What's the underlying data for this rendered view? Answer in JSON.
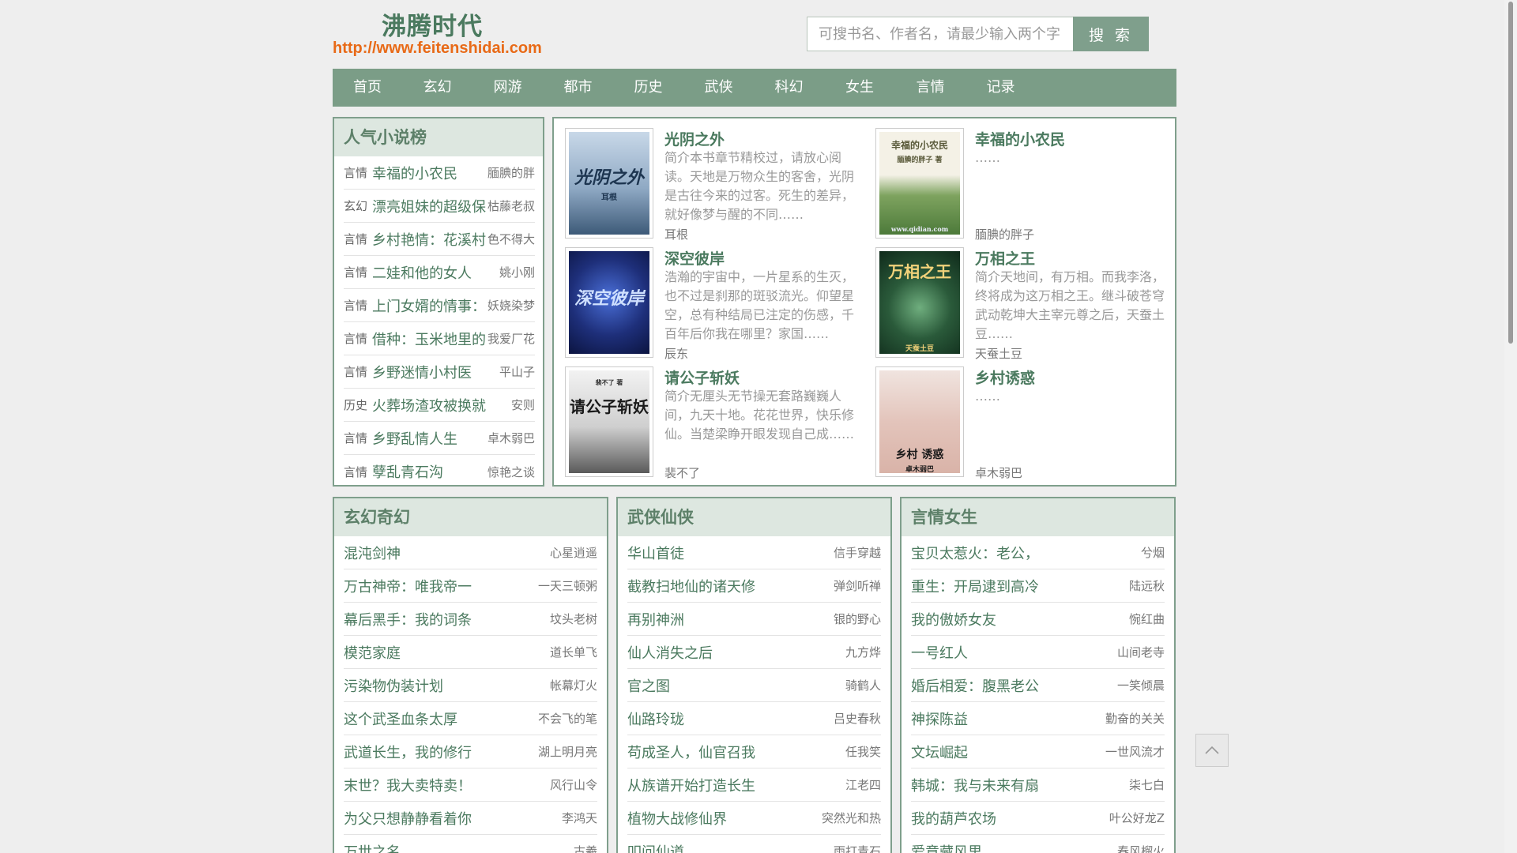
{
  "site": {
    "title": "沸腾时代",
    "url": "http://www.feitenshidai.com"
  },
  "search": {
    "placeholder": "可搜书名、作者名，请最少输入两个字",
    "button_label": "搜 索"
  },
  "nav": [
    "首页",
    "玄幻",
    "网游",
    "都市",
    "历史",
    "武侠",
    "科幻",
    "女生",
    "言情",
    "记录"
  ],
  "ranking": {
    "heading": "人气小说榜",
    "items": [
      {
        "cat": "言情",
        "title": "幸福的小农民",
        "author": "腼腆的胖"
      },
      {
        "cat": "玄幻",
        "title": "漂亮姐妹的超级保",
        "author": "枯藤老叔"
      },
      {
        "cat": "言情",
        "title": "乡村艳情：花溪村",
        "author": "色不得大"
      },
      {
        "cat": "言情",
        "title": "二娃和他的女人",
        "author": "姚小刚"
      },
      {
        "cat": "言情",
        "title": "上门女婿的情事：",
        "author": "妖娆染梦"
      },
      {
        "cat": "言情",
        "title": "借种：玉米地里的",
        "author": "我爱厂花"
      },
      {
        "cat": "言情",
        "title": "乡野迷情小村医",
        "author": "平山子"
      },
      {
        "cat": "历史",
        "title": "火葬场渣攻被换就",
        "author": "安则"
      },
      {
        "cat": "言情",
        "title": "乡野乱情人生",
        "author": "卓木弱巴"
      },
      {
        "cat": "言情",
        "title": "孽乱青石沟",
        "author": "惊艳之谈"
      }
    ]
  },
  "featured": [
    {
      "title": "光阴之外",
      "desc": "简介本书章节精校过，请放心阅读。天地是万物众生的客舍，光阴是古往今来的过客。死生的差异，就好像梦与醒的不同……",
      "author": "耳根",
      "cover_text": "光阴之外",
      "cover_sub": "耳根"
    },
    {
      "title": "幸福的小农民",
      "desc": "……",
      "author": "腼腆的胖子",
      "cover_text": "幸福的小农民",
      "cover_sub": "腼腆的胖子 著",
      "cover_footer": "www.qidian.com"
    },
    {
      "title": "深空彼岸",
      "desc": "浩瀚的宇宙中，一片星系的生灭，也不过是刹那的斑驳流光。仰望星空，总有种结局已注定的伤感，千百年后你我在哪里？家国……",
      "author": "辰东",
      "cover_text": "深空彼岸"
    },
    {
      "title": "万相之王",
      "desc": "简介天地间，有万相。而我李洛，终将成为这万相之王。继斗破苍穹武动乾坤大主宰元尊之后，天蚕土豆……",
      "author": "天蚕土豆",
      "cover_text": "万相之王",
      "cover_sub": "天蚕土豆"
    },
    {
      "title": "请公子斩妖",
      "desc": "简介无厘头无节操无套路巍巍人间，九天十地。花花世界，快乐修仙。当楚梁睁开眼发现自己成……",
      "author": "裴不了",
      "cover_text": "请公子斩妖",
      "cover_sub": "裴不了 著"
    },
    {
      "title": "乡村诱惑",
      "desc": "……",
      "author": "卓木弱巴",
      "cover_text": "乡村 诱惑",
      "cover_sub": "卓木弱巴"
    }
  ],
  "categories": [
    {
      "heading": "玄幻奇幻",
      "items": [
        {
          "title": "混沌剑神",
          "author": "心星逍遥"
        },
        {
          "title": "万古神帝：唯我帝一",
          "author": "一天三顿粥"
        },
        {
          "title": "幕后黑手：我的词条",
          "author": "坟头老树"
        },
        {
          "title": "模范家庭",
          "author": "道长单飞"
        },
        {
          "title": "污染物伪装计划",
          "author": "帐幕灯火"
        },
        {
          "title": "这个武圣血条太厚",
          "author": "不会飞的笔"
        },
        {
          "title": "武道长生，我的修行",
          "author": "湖上明月亮"
        },
        {
          "title": "末世？我大卖特卖！",
          "author": "风行山令"
        },
        {
          "title": "为父只想静静看着你",
          "author": "李鸿天"
        },
        {
          "title": "万世之名",
          "author": "古羲"
        }
      ]
    },
    {
      "heading": "武侠仙侠",
      "items": [
        {
          "title": "华山首徒",
          "author": "信手穿越"
        },
        {
          "title": "截教扫地仙的诸天修",
          "author": "弹剑听禅"
        },
        {
          "title": "再别神洲",
          "author": "银的野心"
        },
        {
          "title": "仙人消失之后",
          "author": "九方烨"
        },
        {
          "title": "官之图",
          "author": "骑鹤人"
        },
        {
          "title": "仙路玲珑",
          "author": "吕史春秋"
        },
        {
          "title": "苟成圣人，仙官召我",
          "author": "任我笑"
        },
        {
          "title": "从族谱开始打造长生",
          "author": "江老四"
        },
        {
          "title": "植物大战修仙界",
          "author": "突然光和热"
        },
        {
          "title": "叩问仙道",
          "author": "雨打青石"
        }
      ]
    },
    {
      "heading": "言情女生",
      "items": [
        {
          "title": "宝贝太惹火：老公，",
          "author": "兮烟"
        },
        {
          "title": "重生：开局逮到高冷",
          "author": "陆远秋"
        },
        {
          "title": "我的傲娇女友",
          "author": "惋红曲"
        },
        {
          "title": "一号红人",
          "author": "山间老寺"
        },
        {
          "title": "婚后相爱：腹黑老公",
          "author": "一笑倾晨"
        },
        {
          "title": "神探陈益",
          "author": "勤奋的关关"
        },
        {
          "title": "文坛崛起",
          "author": "一世风流才"
        },
        {
          "title": "韩城：我与未来有扇",
          "author": "柒七白"
        },
        {
          "title": "我的葫芦农场",
          "author": "叶公好龙Z"
        },
        {
          "title": "爱意藏风里",
          "author": "春风榴火"
        }
      ]
    }
  ],
  "colors": {
    "accent": "#7b9d87",
    "title_green": "#4b7a5f",
    "url_orange": "#e86a17"
  },
  "icons": {
    "back_to_top": "chevron-up-icon"
  }
}
